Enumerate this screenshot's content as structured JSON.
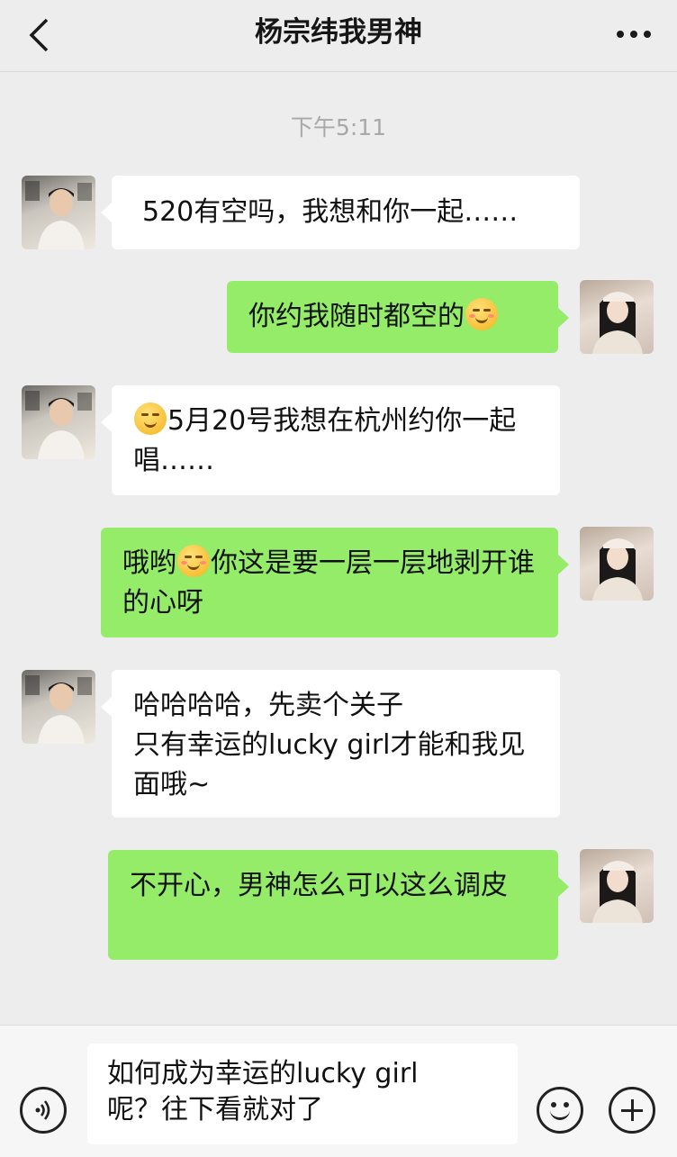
{
  "header": {
    "title": "杨宗纬我男神",
    "back_icon": "chevron-left-icon",
    "more_icon": "more-dots-icon"
  },
  "timestamp": "下午5:11",
  "messages": [
    {
      "side": "left",
      "sender": "contact",
      "text": "520有空吗，我想和你一起……"
    },
    {
      "side": "right",
      "sender": "me",
      "text": "你约我随时都空的",
      "emoji_after": "blush-smile-emoji"
    },
    {
      "side": "left",
      "sender": "contact",
      "emoji_before": "smirk-emoji",
      "text": "5月20号我想在杭州约你一起唱……"
    },
    {
      "side": "right",
      "sender": "me",
      "text_before_emoji": "哦哟",
      "emoji": "grin-emoji",
      "text": "你这是要一层一层地剥开谁的心呀"
    },
    {
      "side": "left",
      "sender": "contact",
      "lines": [
        "哈哈哈哈，先卖个关子",
        "只有幸运的lucky girl才能和我见面哦~"
      ]
    },
    {
      "side": "right",
      "sender": "me",
      "text": "不开心，男神怎么可以这么调皮"
    }
  ],
  "input": {
    "value": "如何成为幸运的lucky girl\n呢？往下看就对了",
    "voice_icon": "voice-icon",
    "emoji_icon": "emoji-icon",
    "plus_icon": "plus-icon"
  },
  "colors": {
    "background": "#ededed",
    "bubble_me": "#95ec69",
    "bubble_contact": "#ffffff"
  }
}
